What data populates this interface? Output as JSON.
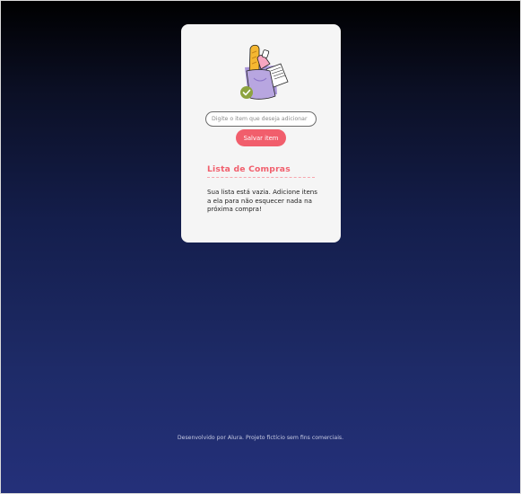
{
  "input": {
    "placeholder": "Digite o item que deseja adicionar",
    "value": ""
  },
  "save_button": {
    "label": "Salvar item"
  },
  "list": {
    "title": "Lista de Compras",
    "empty_message": "Sua lista está vazia. Adicione itens a ela para não esquecer nada na próxima compra!"
  },
  "footer": {
    "text": "Desenvolvido por Alura. Projeto fictício sem fins comerciais."
  },
  "illustration": {
    "icon": "shopping-bag-icon",
    "check_icon": "check-circle-icon"
  },
  "colors": {
    "accent": "#f15e6c",
    "card_background": "#f5f5f5",
    "bag": "#b8a6e0",
    "bread": "#f5b731",
    "check": "#8da33f",
    "background_top": "#000000",
    "background_bottom": "#24307a"
  }
}
